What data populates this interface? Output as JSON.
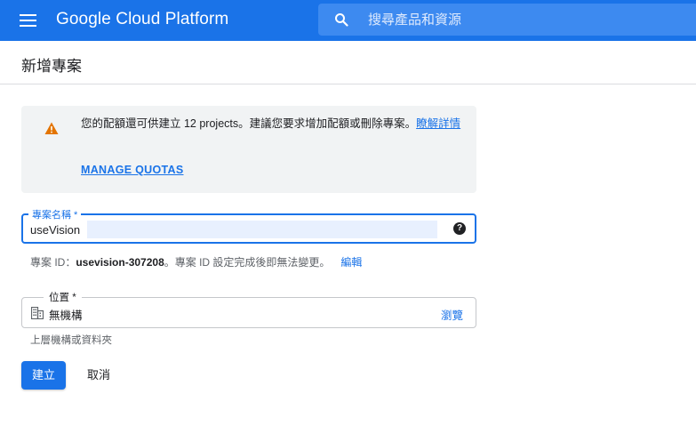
{
  "topbar": {
    "menu_icon": "hamburger-menu-icon",
    "brand": "Google Cloud Platform",
    "search_icon": "search-icon",
    "search_placeholder": "搜尋產品和資源",
    "color": "#1a73e8"
  },
  "page": {
    "title": "新增專案"
  },
  "quota_notice": {
    "icon": "warning-icon",
    "text": "您的配額還可供建立 12 projects。建議您要求增加配額或刪除專案。",
    "learn_more": "瞭解詳情",
    "manage_quotas": "MANAGE QUOTAS"
  },
  "project_name": {
    "label": "專案名稱 *",
    "value": "useVision",
    "help_icon": "help-circle-icon"
  },
  "project_id": {
    "prefix": "專案 ID：",
    "value": "usevision-307208",
    "suffix": "。專案 ID 設定完成後即無法變更。",
    "edit_label": "編輯"
  },
  "location": {
    "label": "位置 *",
    "icon": "building-icon",
    "value": "無機構",
    "browse_label": "瀏覽",
    "hint": "上層機構或資料夾"
  },
  "actions": {
    "create_label": "建立",
    "cancel_label": "取消"
  }
}
